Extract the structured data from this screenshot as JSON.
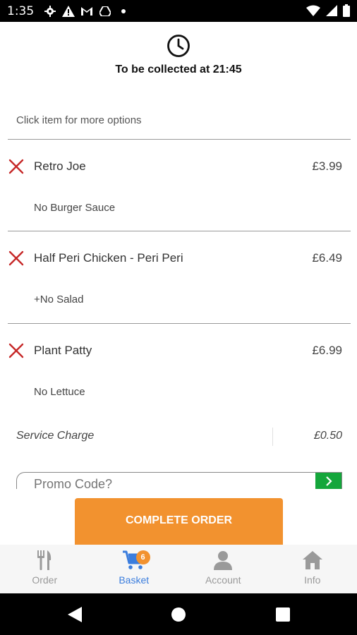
{
  "status_bar": {
    "time": "1:35",
    "left_icons": [
      "gear-icon",
      "warning-icon",
      "gmail-icon",
      "drive-icon",
      "dot-icon"
    ],
    "right_icons": [
      "wifi-icon",
      "signal-icon",
      "battery-icon"
    ]
  },
  "collection": {
    "text": "To be collected at 21:45",
    "icon": "clock-icon"
  },
  "basket": {
    "hint": "Click item for more options",
    "items": [
      {
        "name": "Retro Joe",
        "price": "£3.99",
        "modifier": "No Burger Sauce"
      },
      {
        "name": "Half Peri Chicken - Peri Peri",
        "price": "£6.49",
        "modifier": "+No Salad"
      },
      {
        "name": "Plant Patty",
        "price": "£6.99",
        "modifier": "No Lettuce"
      }
    ],
    "service_charge": {
      "label": "Service Charge",
      "price": "£0.50"
    }
  },
  "promo": {
    "placeholder": "Promo Code?"
  },
  "complete_order_label": "COMPLETE ORDER",
  "tabs": [
    {
      "label": "Order",
      "icon": "fork-knife-icon",
      "active": false
    },
    {
      "label": "Basket",
      "icon": "cart-icon",
      "active": true,
      "badge": "6"
    },
    {
      "label": "Account",
      "icon": "person-icon",
      "active": false
    },
    {
      "label": "Info",
      "icon": "house-icon",
      "active": false
    }
  ],
  "colors": {
    "accent": "#f2922f",
    "active_tab": "#3b7ddd",
    "remove": "#c62828",
    "promo_go": "#14a63b"
  }
}
